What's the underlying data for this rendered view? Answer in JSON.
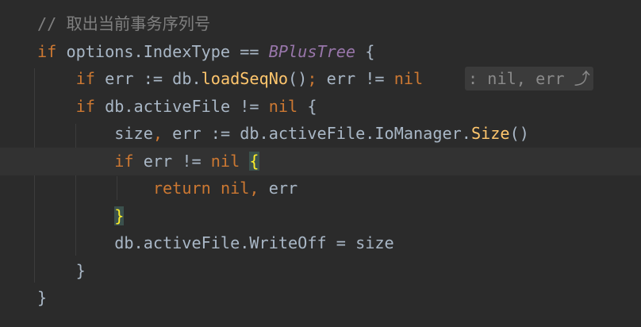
{
  "editor": {
    "lines": [
      {
        "tokens": [
          {
            "t": "// 取出当前事务序列号",
            "c": "cm"
          }
        ]
      },
      {
        "tokens": [
          {
            "t": "if",
            "c": "kw"
          },
          {
            "t": " options.IndexType == ",
            "c": "plain"
          },
          {
            "t": "BPlusTree",
            "c": "ty"
          },
          {
            "t": " {",
            "c": "plain"
          }
        ]
      },
      {
        "tokens": [
          {
            "t": "    ",
            "c": "plain"
          },
          {
            "t": "if",
            "c": "kw"
          },
          {
            "t": " err := db.",
            "c": "plain"
          },
          {
            "t": "loadSeqNo",
            "c": "fn"
          },
          {
            "t": "()",
            "c": "plain"
          },
          {
            "t": ";",
            "c": "kw"
          },
          {
            "t": " err != ",
            "c": "plain"
          },
          {
            "t": "nil",
            "c": "kw"
          }
        ]
      },
      {
        "tokens": [
          {
            "t": "    ",
            "c": "plain"
          },
          {
            "t": "if",
            "c": "kw"
          },
          {
            "t": " db.activeFile != ",
            "c": "plain"
          },
          {
            "t": "nil",
            "c": "kw"
          },
          {
            "t": " {",
            "c": "plain"
          }
        ]
      },
      {
        "tokens": [
          {
            "t": "        size",
            "c": "plain"
          },
          {
            "t": ",",
            "c": "kw"
          },
          {
            "t": " err := db.activeFile.IoManager.",
            "c": "plain"
          },
          {
            "t": "Size",
            "c": "fn"
          },
          {
            "t": "()",
            "c": "plain"
          }
        ]
      },
      {
        "tokens": [
          {
            "t": "        ",
            "c": "plain"
          },
          {
            "t": "if",
            "c": "kw"
          },
          {
            "t": " err != ",
            "c": "plain"
          },
          {
            "t": "nil",
            "c": "kw"
          },
          {
            "t": " ",
            "c": "plain"
          },
          {
            "t": "{",
            "c": "brace-hl"
          }
        ]
      },
      {
        "tokens": [
          {
            "t": "            ",
            "c": "plain"
          },
          {
            "t": "return",
            "c": "kw"
          },
          {
            "t": " ",
            "c": "plain"
          },
          {
            "t": "nil",
            "c": "kw"
          },
          {
            "t": ",",
            "c": "kw"
          },
          {
            "t": " err",
            "c": "plain"
          }
        ]
      },
      {
        "tokens": [
          {
            "t": "        ",
            "c": "plain"
          },
          {
            "t": "}",
            "c": "brace-hl"
          }
        ]
      },
      {
        "tokens": [
          {
            "t": "        db.activeFile.",
            "c": "plain"
          },
          {
            "t": "WriteOff",
            "c": "plain"
          },
          {
            "t": " = size",
            "c": "plain"
          }
        ]
      },
      {
        "tokens": [
          {
            "t": "    }",
            "c": "plain"
          }
        ]
      },
      {
        "tokens": [
          {
            "t": "}",
            "c": "plain"
          }
        ]
      }
    ],
    "inlay_hint": ": nil, err ⤴",
    "current_line_index": 5
  }
}
